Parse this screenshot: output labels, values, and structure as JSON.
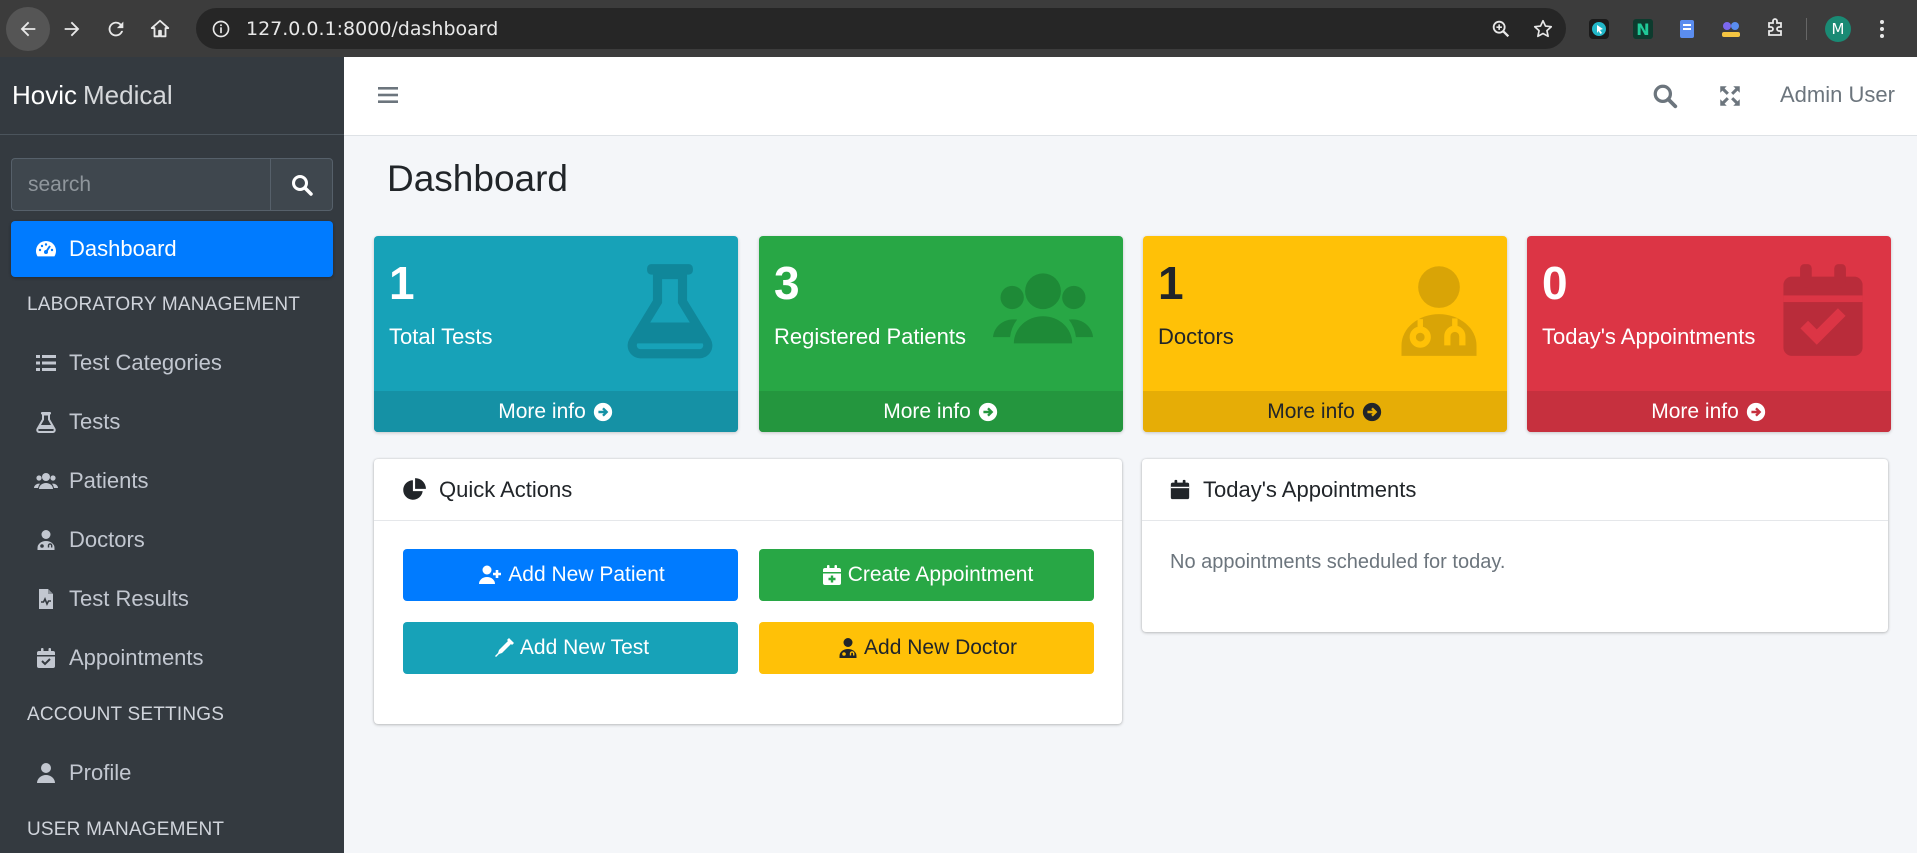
{
  "browser": {
    "url": "127.0.0.1:8000/dashboard",
    "profile_initial": "M"
  },
  "brand": {
    "bold": "Hovic",
    "light": "Medical"
  },
  "sidebar": {
    "search_placeholder": "search",
    "items": [
      {
        "label": "Dashboard",
        "icon": "tachometer-icon",
        "active": true
      },
      {
        "header": "LABORATORY MANAGEMENT"
      },
      {
        "label": "Test Categories",
        "icon": "list-icon"
      },
      {
        "label": "Tests",
        "icon": "flask-icon"
      },
      {
        "label": "Patients",
        "icon": "users-icon"
      },
      {
        "label": "Doctors",
        "icon": "doctor-icon"
      },
      {
        "label": "Test Results",
        "icon": "file-medical-icon"
      },
      {
        "label": "Appointments",
        "icon": "calendar-check-icon"
      },
      {
        "header": "ACCOUNT SETTINGS"
      },
      {
        "label": "Profile",
        "icon": "user-icon"
      },
      {
        "header": "USER MANAGEMENT"
      }
    ]
  },
  "topnav": {
    "user": "Admin User"
  },
  "page": {
    "title": "Dashboard"
  },
  "stats": [
    {
      "value": "1",
      "label": "Total Tests",
      "footer": "More info",
      "color": "#17a2b8",
      "icon": "flask-icon"
    },
    {
      "value": "3",
      "label": "Registered Patients",
      "footer": "More info",
      "color": "#28a745",
      "icon": "users-icon"
    },
    {
      "value": "1",
      "label": "Doctors",
      "footer": "More info",
      "color": "#ffc107",
      "icon": "doctor-icon"
    },
    {
      "value": "0",
      "label": "Today's Appointments",
      "footer": "More info",
      "color": "#dc3545",
      "icon": "calendar-check-icon"
    }
  ],
  "quick_actions": {
    "title": "Quick Actions",
    "buttons": [
      {
        "label": "Add New Patient",
        "color": "#007bff",
        "icon": "user-plus-icon"
      },
      {
        "label": "Create Appointment",
        "color": "#28a745",
        "icon": "calendar-plus-icon"
      },
      {
        "label": "Add New Test",
        "color": "#17a2b8",
        "icon": "syringe-icon"
      },
      {
        "label": "Add New Doctor",
        "color": "#ffc107",
        "icon": "doctor-icon"
      }
    ]
  },
  "appointments": {
    "title": "Today's Appointments",
    "empty_text": "No appointments scheduled for today."
  }
}
